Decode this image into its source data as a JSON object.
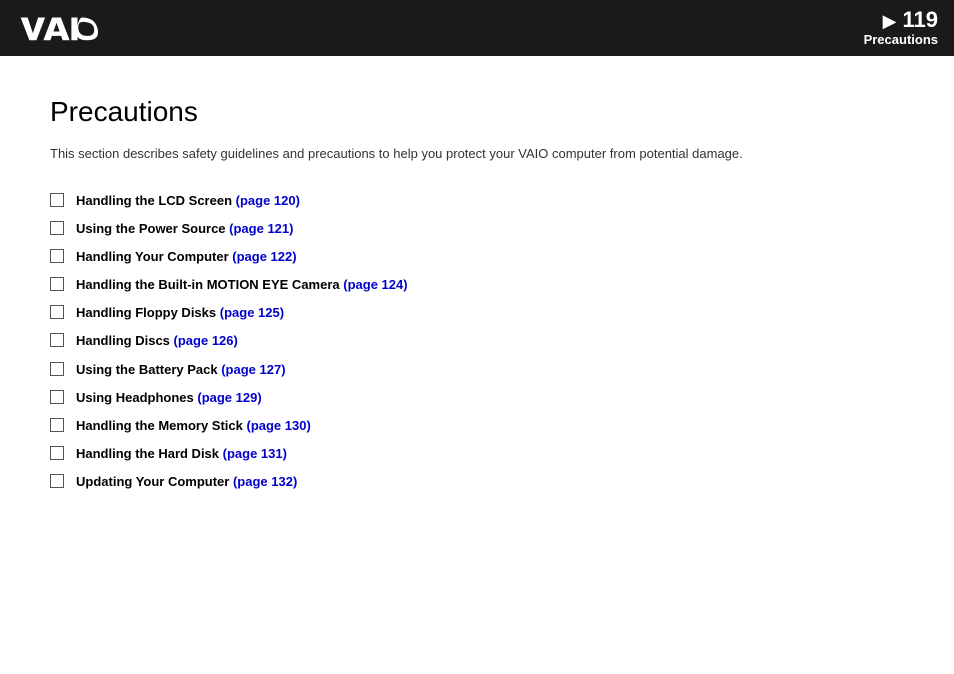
{
  "header": {
    "page_number": "119",
    "arrow": "▶",
    "section_label": "Precautions",
    "bg_color": "#1a1a1a"
  },
  "page": {
    "title": "Precautions",
    "intro": "This section describes safety guidelines and precautions to help you protect your VAIO computer from potential damage.",
    "toc_items": [
      {
        "label": "Handling the LCD Screen",
        "link_text": "(page 120)"
      },
      {
        "label": "Using the Power Source",
        "link_text": "(page 121)"
      },
      {
        "label": "Handling Your Computer",
        "link_text": "(page 122)"
      },
      {
        "label": "Handling the Built-in MOTION EYE Camera",
        "link_text": "(page 124)"
      },
      {
        "label": "Handling Floppy Disks",
        "link_text": "(page 125)"
      },
      {
        "label": "Handling Discs",
        "link_text": "(page 126)"
      },
      {
        "label": "Using the Battery Pack",
        "link_text": "(page 127)"
      },
      {
        "label": "Using Headphones",
        "link_text": "(page 129)"
      },
      {
        "label": "Handling the Memory Stick",
        "link_text": "(page 130)"
      },
      {
        "label": "Handling the Hard Disk",
        "link_text": "(page 131)"
      },
      {
        "label": "Updating Your Computer",
        "link_text": "(page 132)"
      }
    ]
  }
}
